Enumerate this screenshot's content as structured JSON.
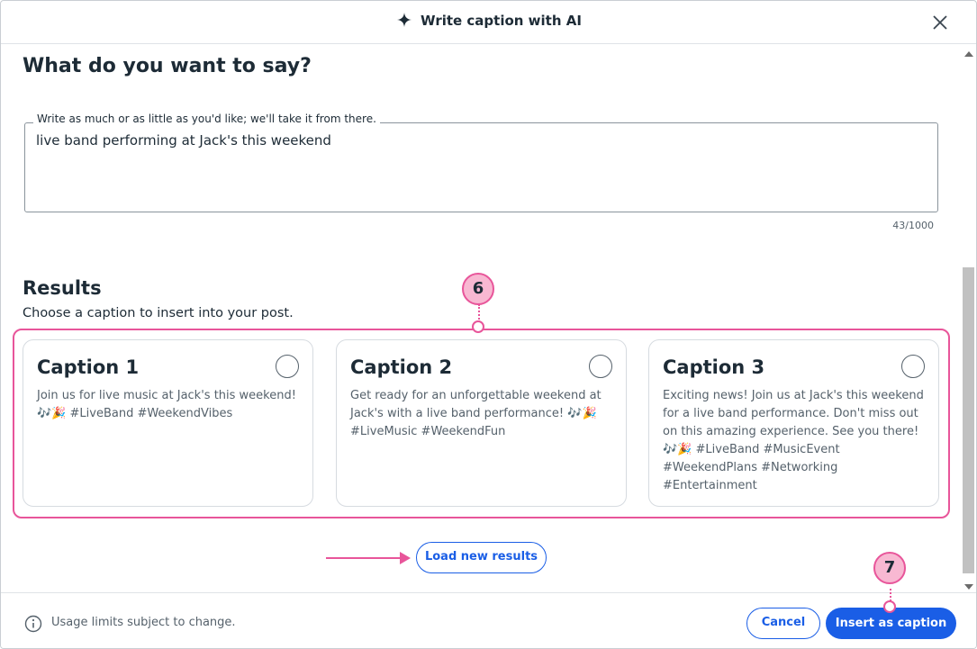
{
  "header": {
    "title": "Write caption with AI"
  },
  "prompt": {
    "heading": "What do you want to say?",
    "legend": "Write as much or as little as you'd like; we'll take it from there.",
    "value": "live band performing at Jack's this weekend",
    "char_count": "43/1000"
  },
  "results": {
    "heading": "Results",
    "subheading": "Choose a caption to insert into your post.",
    "cards": [
      {
        "title": "Caption 1",
        "lines": [
          "Join us for live music at Jack's this weekend!",
          "🎶🎉 #LiveBand #WeekendVibes"
        ]
      },
      {
        "title": "Caption 2",
        "lines": [
          "Get ready for an unforgettable weekend at",
          "Jack's with a live band performance! 🎶🎉",
          "#LiveMusic #WeekendFun"
        ]
      },
      {
        "title": "Caption 3",
        "lines": [
          "Exciting news! Join us at Jack's this weekend",
          "for a live band performance. Don't miss out",
          "on this amazing experience. See you there!",
          "🎶🎉 #LiveBand #MusicEvent",
          "#WeekendPlans #Networking",
          "#Entertainment"
        ]
      }
    ],
    "load_label": "Load new results"
  },
  "callouts": {
    "step6": "6",
    "step7": "7"
  },
  "footer": {
    "note": "Usage limits subject to change.",
    "cancel_label": "Cancel",
    "insert_label": "Insert as caption"
  },
  "colors": {
    "accent": "#1a5ee6",
    "callout": "#e8559a",
    "callout_fill": "#f8b8d2"
  }
}
